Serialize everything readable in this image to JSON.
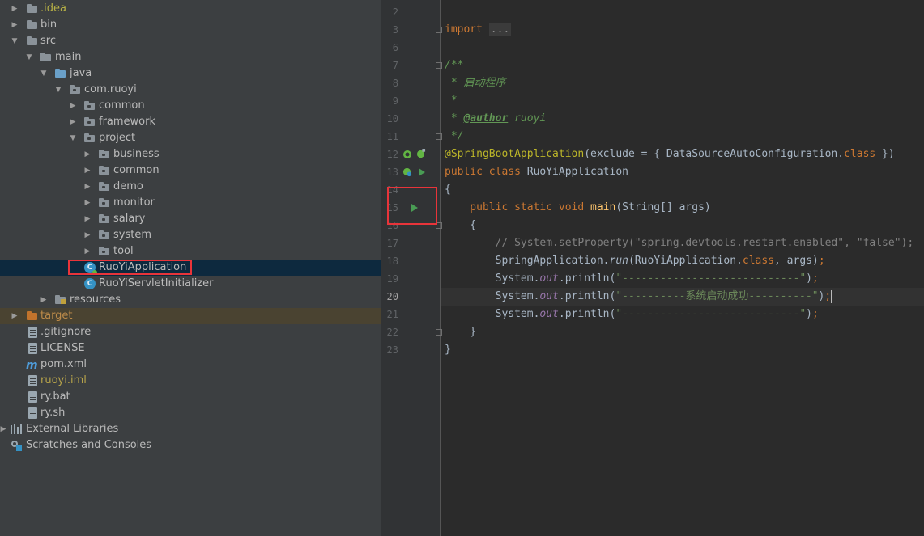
{
  "project_tree": {
    "items": [
      {
        "label": ".idea"
      },
      {
        "label": "bin"
      },
      {
        "label": "src"
      },
      {
        "label": "main"
      },
      {
        "label": "java"
      },
      {
        "label": "com.ruoyi"
      },
      {
        "label": "common"
      },
      {
        "label": "framework"
      },
      {
        "label": "project"
      },
      {
        "label": "business"
      },
      {
        "label": "common"
      },
      {
        "label": "demo"
      },
      {
        "label": "monitor"
      },
      {
        "label": "salary"
      },
      {
        "label": "system"
      },
      {
        "label": "tool"
      },
      {
        "label": "RuoYiApplication",
        "selected": true
      },
      {
        "label": "RuoYiServletInitializer"
      },
      {
        "label": "resources"
      },
      {
        "label": "target"
      },
      {
        "label": ".gitignore"
      },
      {
        "label": "LICENSE"
      },
      {
        "label": "pom.xml"
      },
      {
        "label": "ruoyi.iml"
      },
      {
        "label": "ry.bat"
      },
      {
        "label": "ry.sh"
      },
      {
        "label": "External Libraries"
      },
      {
        "label": "Scratches and Consoles"
      }
    ]
  },
  "editor": {
    "line_numbers": [
      "2",
      "3",
      "6",
      "7",
      "8",
      "9",
      "10",
      "11",
      "12",
      "13",
      "14",
      "15",
      "16",
      "17",
      "18",
      "19",
      "20",
      "21",
      "22",
      "23"
    ],
    "current_line": "20",
    "code": {
      "l3_kw": "import",
      "l3_fold": "...",
      "l7": "/**",
      "l8": " * 启动程序",
      "l9": " *",
      "l10_pre": " * ",
      "l10_tag": "@author",
      "l10_val": " ruoyi",
      "l11": " */",
      "l12_ann": "@SpringBootApplication",
      "l12_a": "(exclude = { DataSourceAutoConfiguration.",
      "l12_kw": "class",
      "l12_b": " })",
      "l13_kw": "public class ",
      "l13_name": "RuoYiApplication",
      "l14": "{",
      "l15_kw": "    public static void ",
      "l15_fn": "main",
      "l15_rest": "(String[] args)",
      "l16": "    {",
      "l17": "        // System.setProperty(\"spring.devtools.restart.enabled\", \"false\");",
      "l18_a": "        SpringApplication.",
      "l18_run": "run",
      "l18_b": "(RuoYiApplication.",
      "l18_kw": "class",
      "l18_c": ", args)",
      "l18_semi": ";",
      "sys_prefix": "        System.",
      "sys_out": "out",
      "sys_println": ".println(",
      "l19_str": "\"----------------------------\"",
      "l20_str": "\"----------系统启动成功----------\"",
      "l21_str": "\"----------------------------\"",
      "sys_end": ")",
      "semi": ";",
      "l22": "    }",
      "l23": "}"
    }
  },
  "icons": {
    "run": "run-icon",
    "spring_bean": "spring-bean-icon",
    "class": "java-class-icon"
  }
}
